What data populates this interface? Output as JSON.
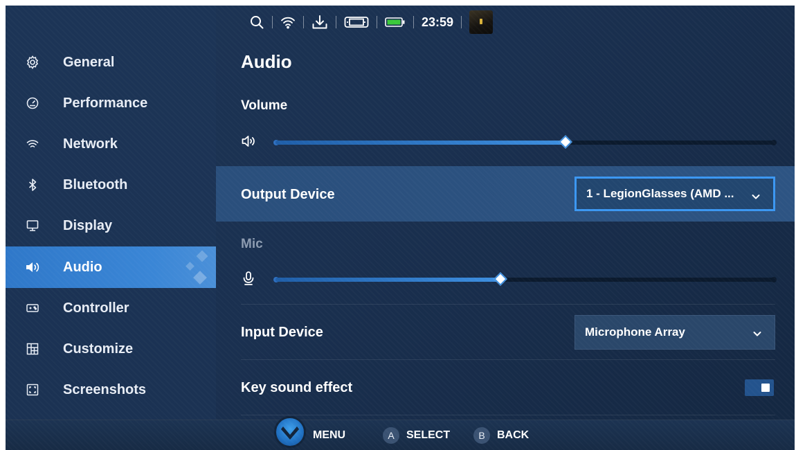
{
  "status_bar": {
    "icons": [
      "search-icon",
      "wifi-icon",
      "download-icon",
      "device-icon",
      "battery-icon"
    ],
    "time": "23:59",
    "battery_color": "#3ac93a"
  },
  "sidebar": {
    "active_index": 5,
    "items": [
      {
        "label": "General",
        "icon": "gear-icon"
      },
      {
        "label": "Performance",
        "icon": "gauge-icon"
      },
      {
        "label": "Network",
        "icon": "wifi-icon"
      },
      {
        "label": "Bluetooth",
        "icon": "bluetooth-icon"
      },
      {
        "label": "Display",
        "icon": "monitor-icon"
      },
      {
        "label": "Audio",
        "icon": "speaker-icon"
      },
      {
        "label": "Controller",
        "icon": "controller-icon"
      },
      {
        "label": "Customize",
        "icon": "grid-icon"
      },
      {
        "label": "Screenshots",
        "icon": "screenshot-icon"
      }
    ]
  },
  "main": {
    "title": "Audio",
    "volume": {
      "label": "Volume",
      "level": 0.58
    },
    "output_device": {
      "label": "Output Device",
      "value": "1 - LegionGlasses (AMD ..."
    },
    "mic": {
      "label": "Mic",
      "level": 0.45
    },
    "input_device": {
      "label": "Input Device",
      "value": "Microphone Array"
    },
    "key_sound": {
      "label": "Key sound effect",
      "enabled": true
    }
  },
  "hints": {
    "menu": "MENU",
    "select_key": "A",
    "select": "SELECT",
    "back_key": "B",
    "back": "BACK"
  },
  "colors": {
    "accent": "#3b97f2",
    "active_nav": "#3a86d6",
    "background": "#1a3050"
  }
}
